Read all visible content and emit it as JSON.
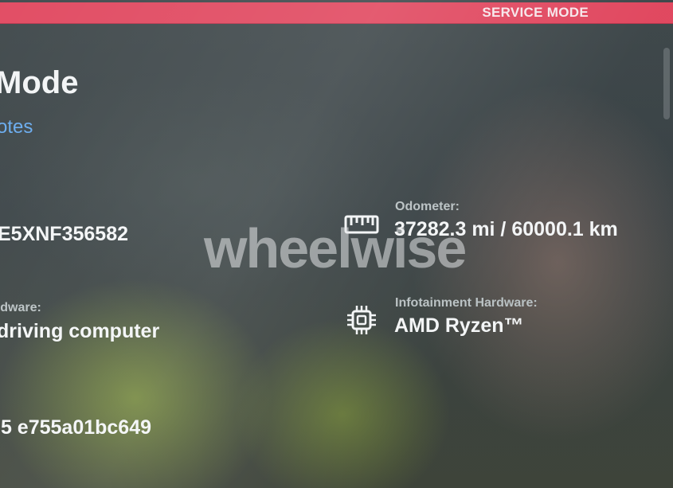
{
  "header": {
    "mode_label": "SERVICE MODE"
  },
  "page": {
    "title": "Mode",
    "notes_link": "otes"
  },
  "vehicle": {
    "vin_value": "E5XNF356582",
    "hardware_label": "rdware:",
    "hardware_value": "driving computer",
    "firmware_value": ".5 e755a01bc649",
    "odometer_label": "Odometer:",
    "odometer_value": "37282.3 mi / 60000.1 km",
    "infotainment_label": "Infotainment Hardware:",
    "infotainment_value": "AMD Ryzen™"
  },
  "watermark": {
    "text": "wheelwise"
  },
  "icons": {
    "odometer": "ruler-icon",
    "infotainment": "chip-icon"
  },
  "colors": {
    "accent": "#e0455d",
    "link": "#63a8ee"
  }
}
